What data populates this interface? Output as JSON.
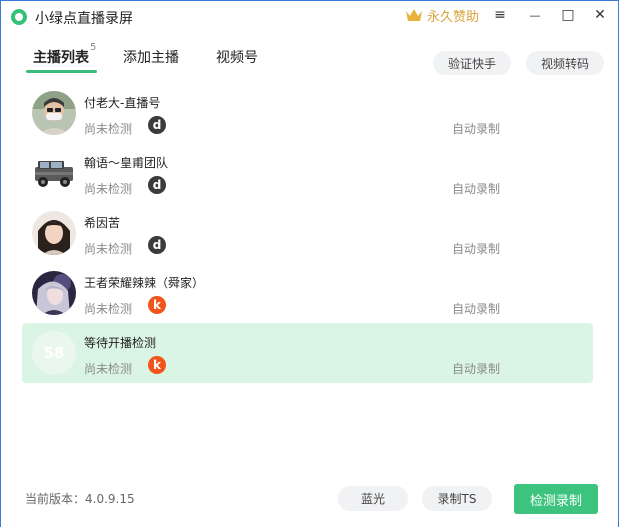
{
  "app": {
    "title": "小绿点直播录屏",
    "sponsor_label": "永久赞助"
  },
  "window_controls": {
    "menu": "≡",
    "minimize": "—",
    "maximize": "□",
    "close": "✕"
  },
  "tabs": [
    {
      "label": "主播列表",
      "active": true,
      "badge": "5"
    },
    {
      "label": "添加主播",
      "active": false
    },
    {
      "label": "视频号",
      "active": false
    }
  ],
  "actions": {
    "verify_kuaishou": "验证快手",
    "video_transcode": "视频转码"
  },
  "streamers": [
    {
      "name": "付老大-直播号",
      "status": "尚未检测",
      "platform": "douyin",
      "platform_glyph": "d",
      "record_mode": "自动录制",
      "avatar": "photo-man"
    },
    {
      "name": "翰语～皇甫团队",
      "status": "尚未检测",
      "platform": "douyin",
      "platform_glyph": "d",
      "record_mode": "自动录制",
      "avatar": "car"
    },
    {
      "name": "希因苦",
      "status": "尚未检测",
      "platform": "douyin",
      "platform_glyph": "d",
      "record_mode": "自动录制",
      "avatar": "photo-woman"
    },
    {
      "name": "王者荣耀辣辣（舜家）",
      "status": "尚未检测",
      "platform": "kuaishou",
      "platform_glyph": "k",
      "record_mode": "自动录制",
      "avatar": "anime"
    },
    {
      "name": "等待开播检测",
      "status": "尚未检测",
      "platform": "kuaishou",
      "platform_glyph": "k",
      "record_mode": "自动录制",
      "avatar": "placeholder",
      "avatar_text": "58",
      "selected": true
    }
  ],
  "footer": {
    "version": "当前版本：4.0.9.15",
    "bluray": "蓝光",
    "record_ts": "录制TS",
    "detect_record": "检测录制"
  },
  "colors": {
    "accent": "#3cc37d",
    "selected_row": "#dbf5e5",
    "kuaishou": "#f2541b",
    "douyin": "#3b3b3b",
    "sponsor": "#d9a43a"
  }
}
